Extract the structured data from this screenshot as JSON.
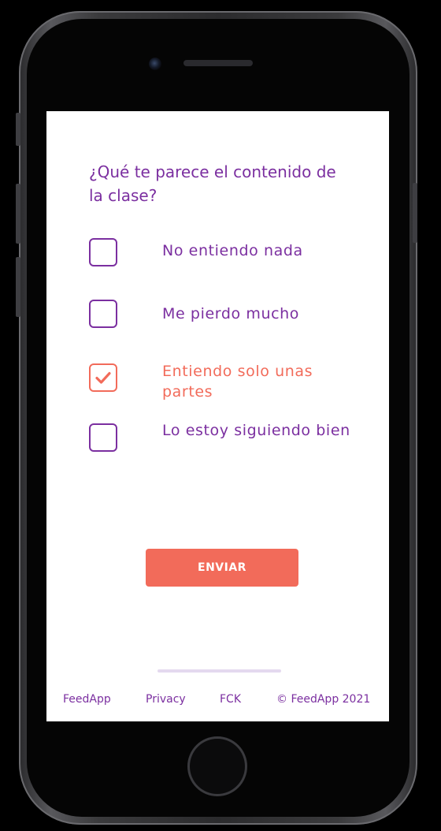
{
  "survey": {
    "question": "¿Qué te parece el contenido de la clase?",
    "options": [
      {
        "label": "No entiendo nada",
        "checked": false
      },
      {
        "label": "Me pierdo mucho",
        "checked": false
      },
      {
        "label": "Entiendo solo unas partes",
        "checked": true
      },
      {
        "label": "Lo estoy siguiendo bien",
        "checked": false
      }
    ],
    "submit_label": "ENVIAR"
  },
  "footer": {
    "links": [
      "FeedApp",
      "Privacy",
      "FCK",
      "© FeedApp 2021"
    ]
  },
  "colors": {
    "primary": "#7b2fa0",
    "accent": "#f26b5a",
    "divider": "#e4d9ef"
  },
  "icons": {
    "checked": "checkmark-icon",
    "camera": "front-camera-icon"
  }
}
